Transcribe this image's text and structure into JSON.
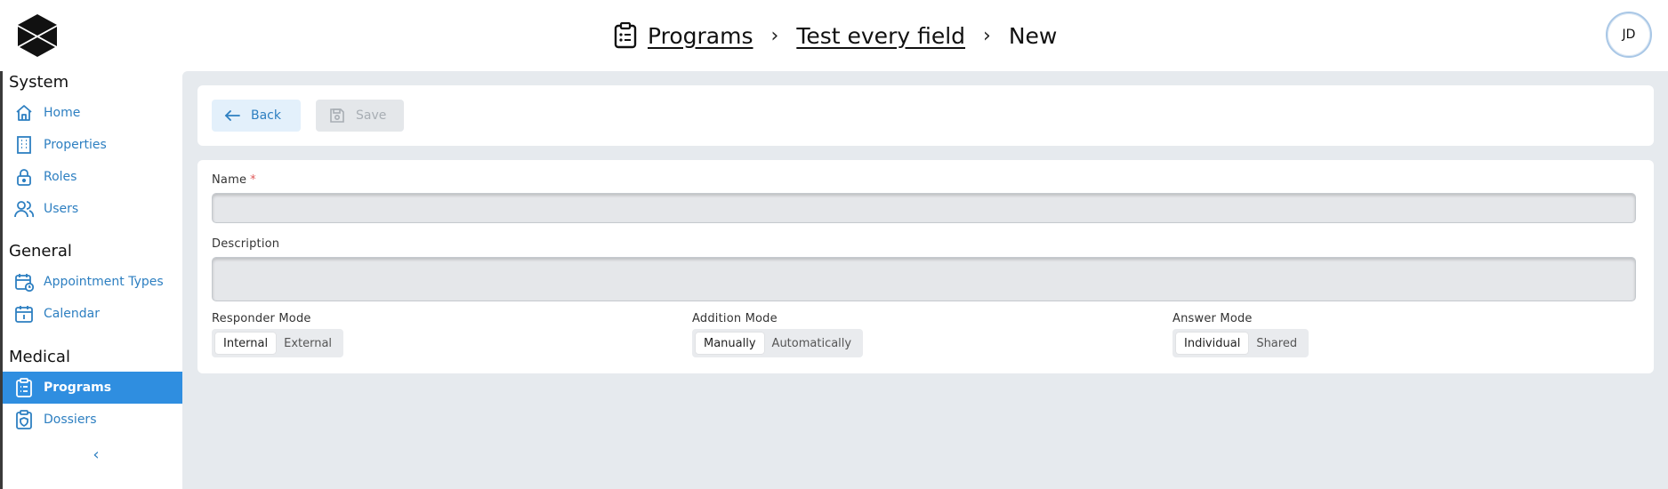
{
  "header": {
    "breadcrumb": [
      {
        "label": "Programs"
      },
      {
        "label": "Test every field"
      },
      {
        "label": "New"
      }
    ],
    "separator": "›",
    "avatar_initials": "JD"
  },
  "sidebar": {
    "sections": [
      {
        "title": "System",
        "items": [
          {
            "label": "Home",
            "icon": "home-icon"
          },
          {
            "label": "Properties",
            "icon": "building-icon"
          },
          {
            "label": "Roles",
            "icon": "lock-icon"
          },
          {
            "label": "Users",
            "icon": "users-icon"
          }
        ]
      },
      {
        "title": "General",
        "items": [
          {
            "label": "Appointment Types",
            "icon": "calendar-clock-icon"
          },
          {
            "label": "Calendar",
            "icon": "calendar-icon"
          }
        ]
      },
      {
        "title": "Medical",
        "items": [
          {
            "label": "Programs",
            "icon": "clipboard-list-icon",
            "active": true
          },
          {
            "label": "Dossiers",
            "icon": "clipboard-shield-icon"
          }
        ]
      }
    ],
    "collapse_glyph": "‹"
  },
  "toolbar": {
    "back_label": "Back",
    "save_label": "Save"
  },
  "form": {
    "name": {
      "label": "Name",
      "required_mark": "*",
      "value": ""
    },
    "description": {
      "label": "Description",
      "value": ""
    },
    "responder_mode": {
      "label": "Responder Mode",
      "options": [
        "Internal",
        "External"
      ],
      "selected": "Internal"
    },
    "addition_mode": {
      "label": "Addition Mode",
      "options": [
        "Manually",
        "Automatically"
      ],
      "selected": "Manually"
    },
    "answer_mode": {
      "label": "Answer Mode",
      "options": [
        "Individual",
        "Shared"
      ],
      "selected": "Individual"
    }
  },
  "colors": {
    "accent": "#2f8ee0",
    "link": "#2d7fc1",
    "background": "#e6eaee",
    "required": "#e05a5a"
  }
}
